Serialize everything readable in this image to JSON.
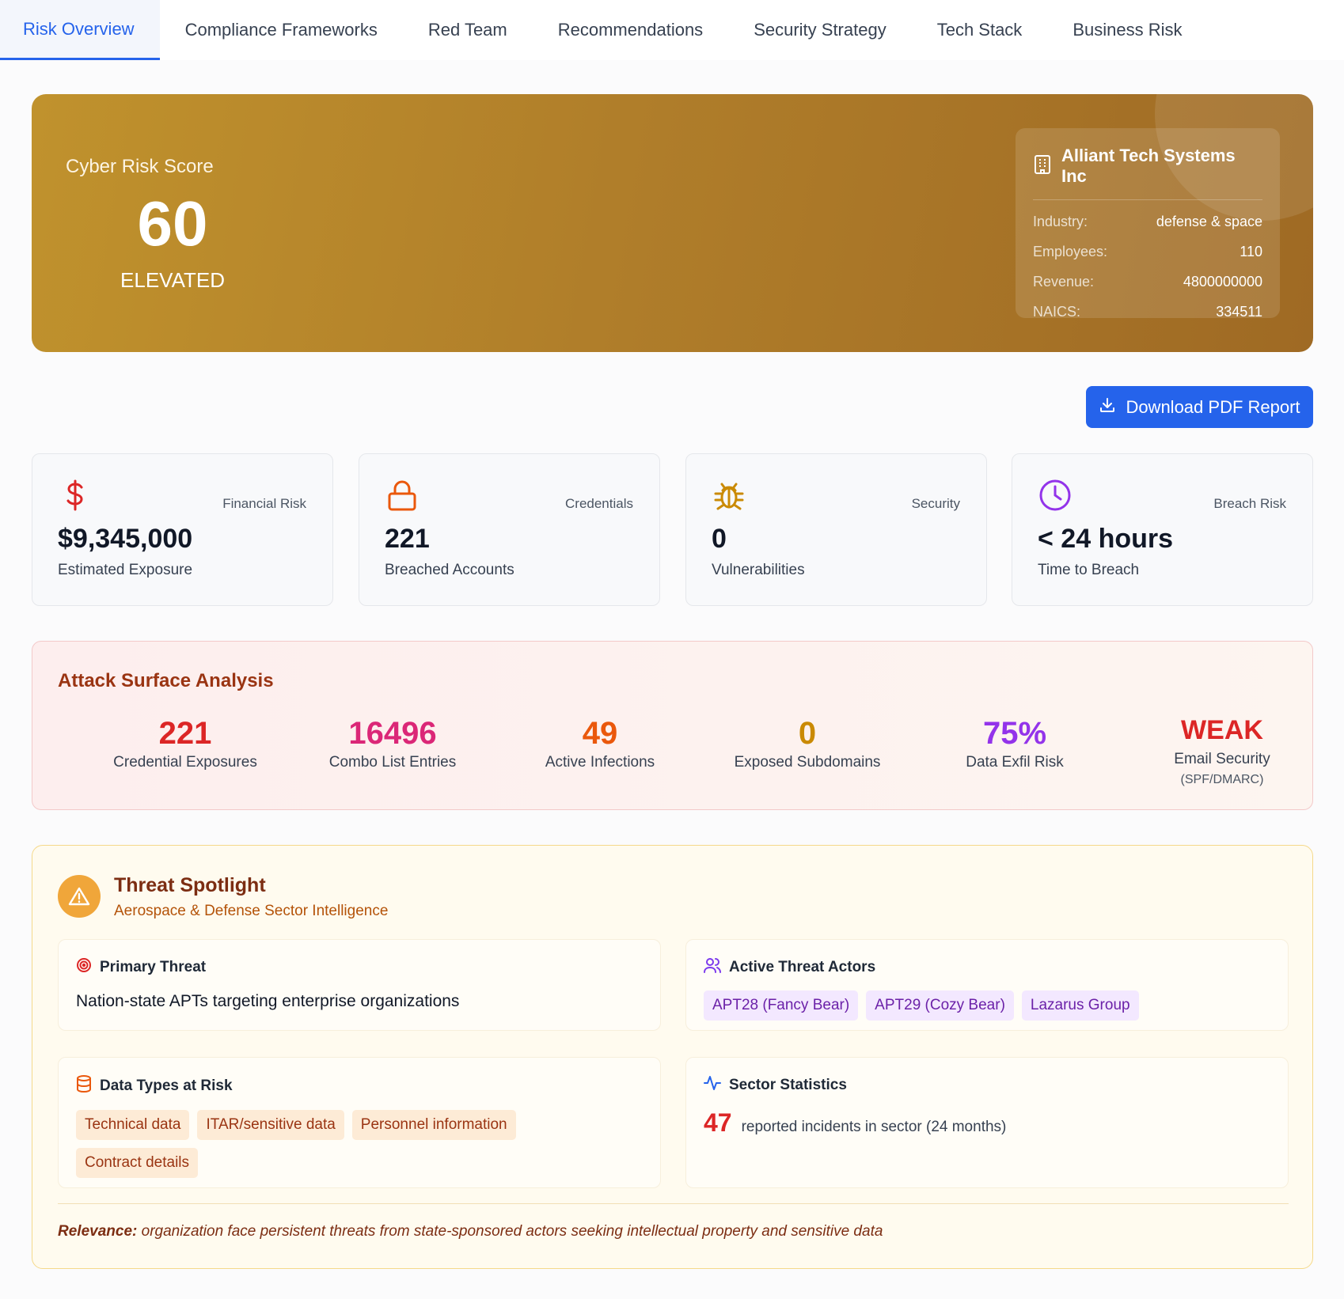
{
  "tabs": [
    {
      "label": "Risk Overview",
      "active": true
    },
    {
      "label": "Compliance Frameworks"
    },
    {
      "label": "Red Team"
    },
    {
      "label": "Recommendations"
    },
    {
      "label": "Security Strategy"
    },
    {
      "label": "Tech Stack"
    },
    {
      "label": "Business Risk"
    }
  ],
  "hero": {
    "score_label": "Cyber Risk Score",
    "score": "60",
    "level": "ELEVATED",
    "company": {
      "name": "Alliant Tech Systems Inc",
      "icon": "building-icon",
      "rows": [
        {
          "key": "Industry:",
          "value": "defense & space"
        },
        {
          "key": "Employees:",
          "value": "110"
        },
        {
          "key": "Revenue:",
          "value": "4800000000"
        },
        {
          "key": "NAICS:",
          "value": "334511"
        }
      ]
    }
  },
  "download": {
    "label": "Download PDF Report",
    "icon": "download-icon"
  },
  "metrics": [
    {
      "category": "Financial Risk",
      "value": "$9,345,000",
      "sub": "Estimated Exposure",
      "icon": "dollar-icon",
      "color": "#dc2626"
    },
    {
      "category": "Credentials",
      "value": "221",
      "sub": "Breached Accounts",
      "icon": "lock-icon",
      "color": "#ea580c"
    },
    {
      "category": "Security",
      "value": "0",
      "sub": "Vulnerabilities",
      "icon": "bug-icon",
      "color": "#ca8a04"
    },
    {
      "category": "Breach Risk",
      "value": "< 24 hours",
      "sub": "Time to Breach",
      "icon": "clock-icon",
      "color": "#9333ea"
    }
  ],
  "attack": {
    "title": "Attack Surface Analysis",
    "items": [
      {
        "value": "221",
        "label": "Credential Exposures",
        "color": "#dc2626"
      },
      {
        "value": "16496",
        "label": "Combo List Entries",
        "color": "#db2777"
      },
      {
        "value": "49",
        "label": "Active Infections",
        "color": "#ea580c"
      },
      {
        "value": "0",
        "label": "Exposed Subdomains",
        "color": "#ca8a04"
      },
      {
        "value": "75%",
        "label": "Data Exfil Risk",
        "color": "#9333ea"
      },
      {
        "value": "WEAK",
        "label": "Email Security",
        "note": "(SPF/DMARC)",
        "color": "#dc2626"
      }
    ]
  },
  "threat": {
    "title": "Threat Spotlight",
    "subtitle": "Aerospace & Defense Sector Intelligence",
    "primary": {
      "heading": "Primary Threat",
      "text": "Nation-state APTs targeting enterprise organizations"
    },
    "actors": {
      "heading": "Active Threat Actors",
      "list": [
        "APT28 (Fancy Bear)",
        "APT29 (Cozy Bear)",
        "Lazarus Group"
      ]
    },
    "data_types": {
      "heading": "Data Types at Risk",
      "list": [
        "Technical data",
        "ITAR/sensitive data",
        "Personnel information",
        "Contract details"
      ]
    },
    "sector": {
      "heading": "Sector Statistics",
      "number": "47",
      "text": "reported incidents in sector (24 months)"
    },
    "relevance_label": "Relevance:",
    "relevance_text": "organization face persistent threats from state-sponsored actors seeking intellectual property and sensitive data"
  }
}
